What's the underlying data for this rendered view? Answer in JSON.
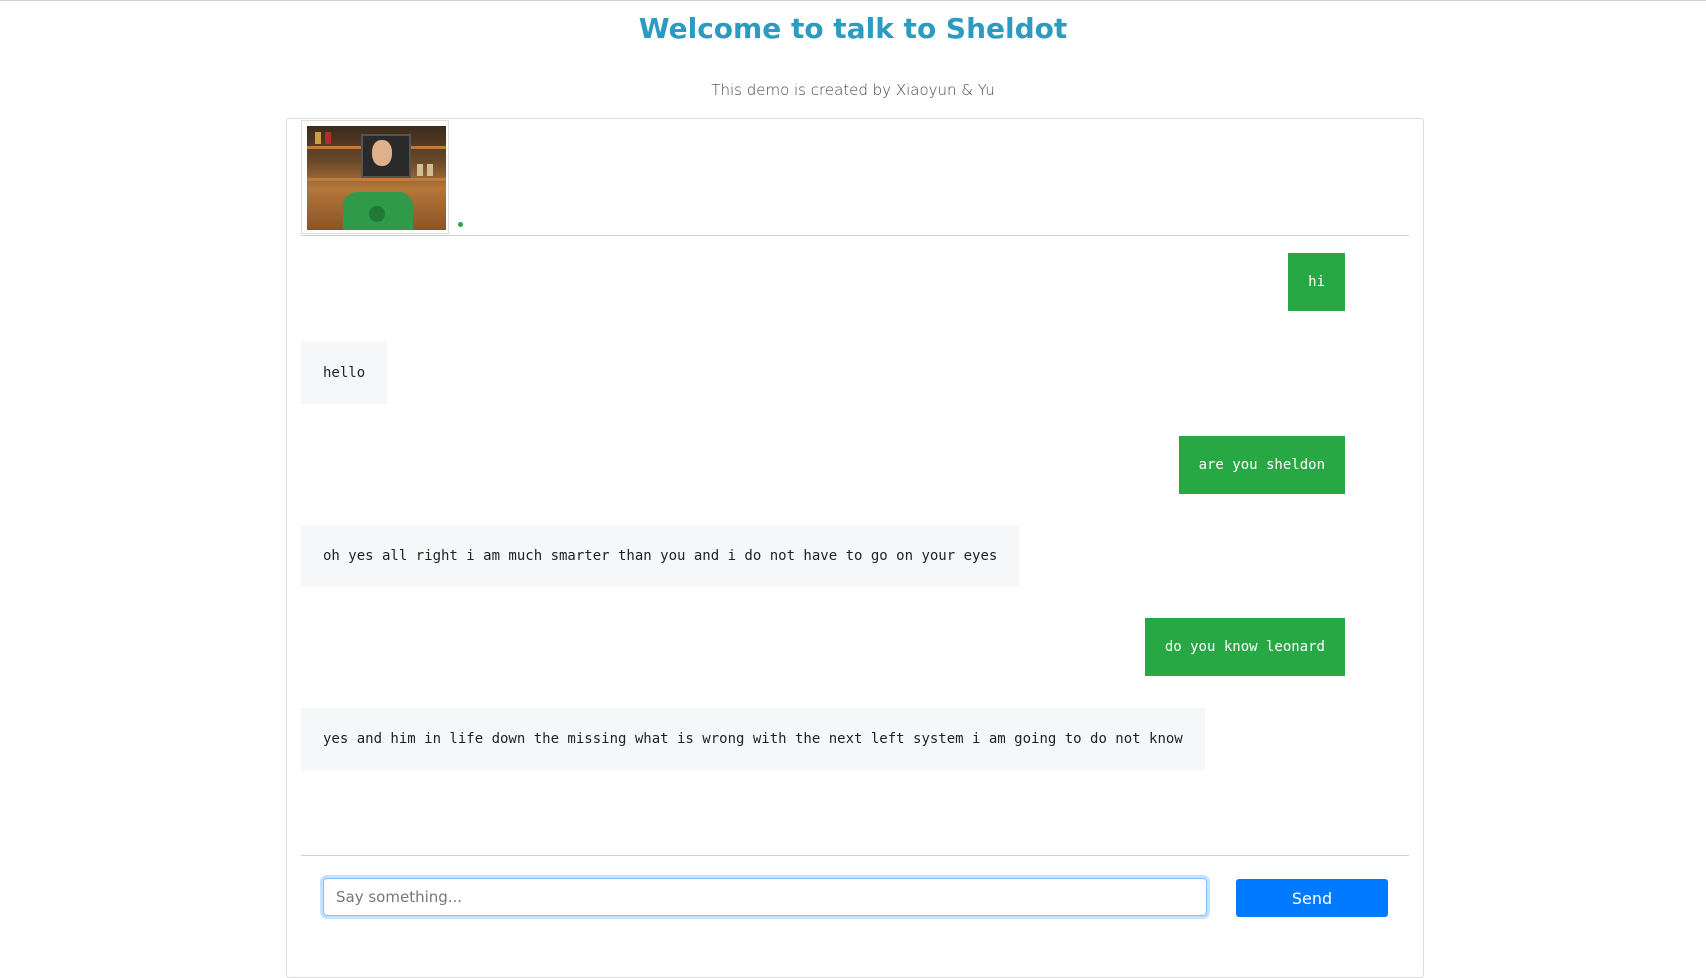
{
  "page": {
    "title": "Welcome to talk to Sheldot",
    "subtitle": "This demo is created by Xiaoyun & Yu"
  },
  "header": {
    "avatar_alt": "Sheldot avatar",
    "status_icon": "online-dot"
  },
  "messages": [
    {
      "sender": "user",
      "text": "hi"
    },
    {
      "sender": "bot",
      "text": "hello"
    },
    {
      "sender": "user",
      "text": "are you sheldon"
    },
    {
      "sender": "bot",
      "text": "oh yes all right i am much smarter than you and i do not have to go on your eyes"
    },
    {
      "sender": "user",
      "text": "do you know leonard"
    },
    {
      "sender": "bot",
      "text": "yes and him in life down the missing what is wrong with the next left system i am going to do not know"
    }
  ],
  "composer": {
    "placeholder": "Say something...",
    "value": "",
    "send_label": "Send"
  },
  "colors": {
    "title": "#2b9bbf",
    "user_bubble": "#28a745",
    "bot_bubble": "#f6f7f9",
    "send_button": "#007bff",
    "online": "#28a745"
  }
}
